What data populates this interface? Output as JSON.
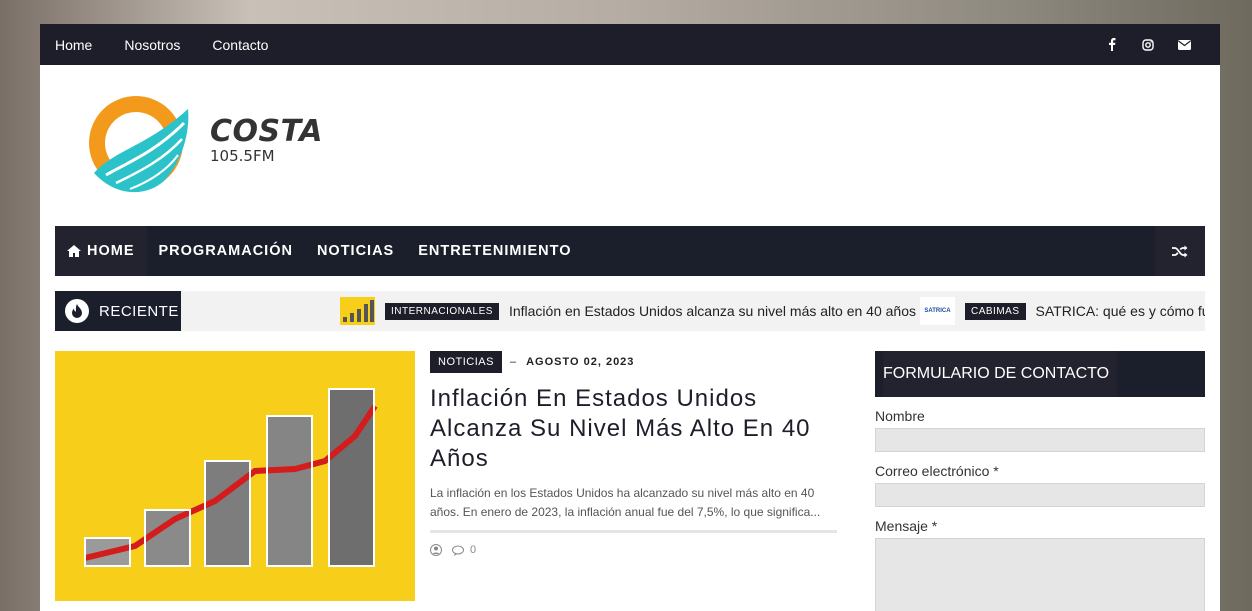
{
  "topbar": {
    "links": [
      "Home",
      "Nosotros",
      "Contacto"
    ],
    "social_icons": [
      "facebook-icon",
      "instagram-icon",
      "email-icon"
    ]
  },
  "logo": {
    "name": "COSTA",
    "frequency": "105.5FM"
  },
  "mainnav": {
    "items": [
      "HOME",
      "PROGRAMACIÓN",
      "NOTICIAS",
      "ENTRETENIMIENTO"
    ],
    "home_icon": "home-icon",
    "shuffle_icon": "shuffle-icon"
  },
  "ticker": {
    "label": "RECIENTE",
    "items": [
      {
        "category": "INTERNACIONALES",
        "title": "Inflación en Estados Unidos alcanza su nivel más alto en 40 años"
      },
      {
        "category": "CABIMAS",
        "thumb_text": "SATRICA",
        "title": "SATRICA: qué es y cómo fu"
      }
    ]
  },
  "post": {
    "category": "NOTICIAS",
    "date": "AGOSTO 02, 2023",
    "title": "Inflación En Estados Unidos Alcanza Su Nivel Más Alto En 40 Años",
    "excerpt": " La inflación en los Estados Unidos ha alcanzado su nivel más alto en 40 años. En enero de 2023, la inflación anual fue del 7,5%, lo que significa...",
    "comments": "0"
  },
  "sidebar": {
    "title": "FORMULARIO DE CONTACTO",
    "fields": [
      "Nombre",
      "Correo electrónico *",
      "Mensaje *"
    ]
  },
  "colors": {
    "dark": "#1e1e2a",
    "yellow": "#f7cf1a",
    "logo_orange": "#f39a1c",
    "logo_teal": "#2bc3c9"
  }
}
